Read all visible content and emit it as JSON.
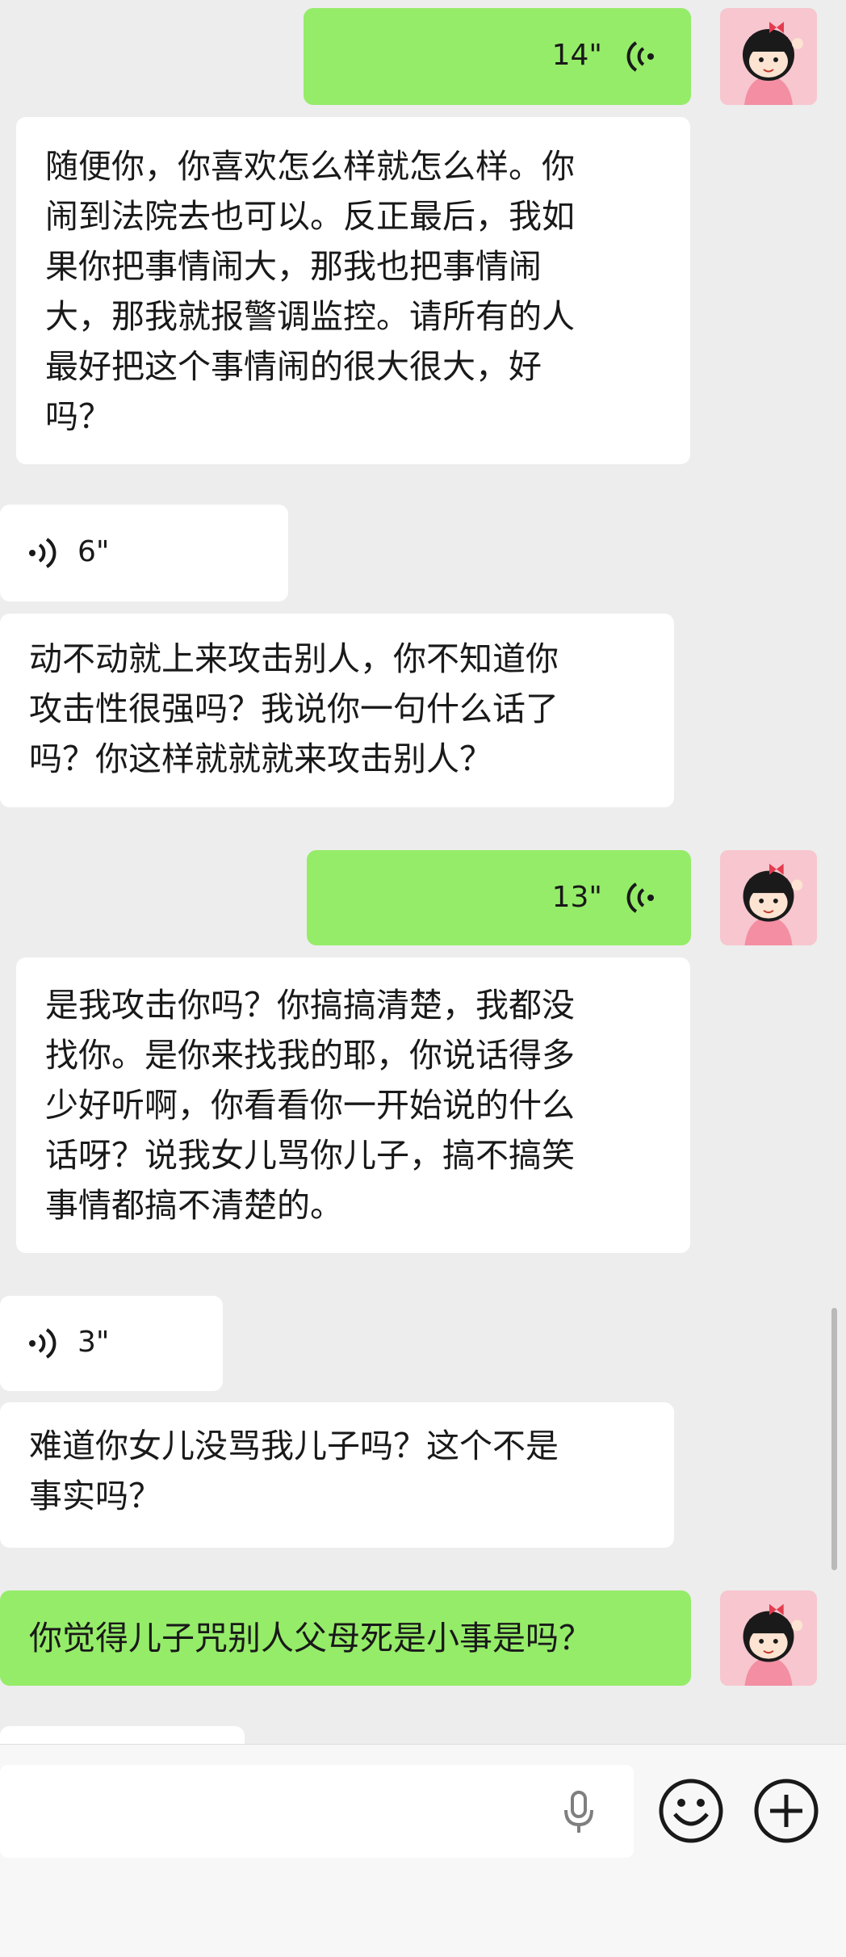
{
  "messages": [
    {
      "type": "voice",
      "side": "right",
      "duration": "14\""
    },
    {
      "type": "text",
      "side": "left",
      "text": "随便你，你喜欢怎么样就怎么样。你\n闹到法院去也可以。反正最后，我如\n果你把事情闹大，那我也把事情闹\n大，那我就报警调监控。请所有的人\n最好把这个事情闹的很大很大，好\n吗？"
    },
    {
      "type": "voice",
      "side": "left",
      "duration": "6\""
    },
    {
      "type": "text",
      "side": "left",
      "text": "动不动就上来攻击别人，你不知道你\n攻击性很强吗？我说你一句什么话了\n吗？你这样就就就来攻击别人？"
    },
    {
      "type": "voice",
      "side": "right",
      "duration": "13\""
    },
    {
      "type": "text",
      "side": "left",
      "text": "是我攻击你吗？你搞搞清楚，我都没\n找你。是你来找我的耶，你说话得多\n少好听啊，你看看你一开始说的什么\n话呀？说我女儿骂你儿子，搞不搞笑\n事情都搞不清楚的。"
    },
    {
      "type": "voice",
      "side": "left",
      "duration": "3\""
    },
    {
      "type": "text",
      "side": "left",
      "text": "难道你女儿没骂我儿子吗？这个不是\n事实吗？"
    },
    {
      "type": "text",
      "side": "right",
      "text": "你觉得儿子咒别人父母死是小事是吗？"
    }
  ],
  "input_bar": {
    "input_value": "",
    "icons": [
      "microphone-icon",
      "emoji-icon",
      "plus-icon"
    ]
  },
  "colors": {
    "background": "#ededed",
    "bubble_self": "#95ec69",
    "bubble_other": "#ffffff",
    "text": "#191919",
    "avatar_bg": "#f7c6cf"
  }
}
